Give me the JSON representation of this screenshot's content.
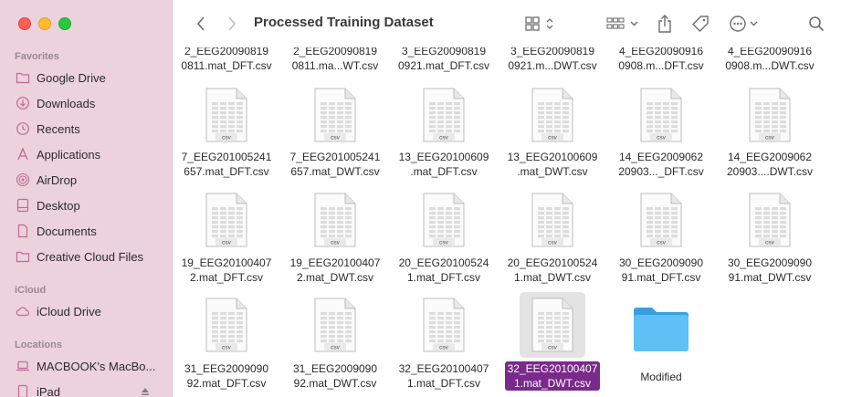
{
  "window": {
    "title": "Processed Training Dataset"
  },
  "sidebar": {
    "sections": [
      {
        "heading": "Favorites",
        "items": [
          {
            "label": "Google Drive",
            "icon": "folder-icon"
          },
          {
            "label": "Downloads",
            "icon": "download-icon"
          },
          {
            "label": "Recents",
            "icon": "clock-icon"
          },
          {
            "label": "Applications",
            "icon": "applications-icon"
          },
          {
            "label": "AirDrop",
            "icon": "airdrop-icon"
          },
          {
            "label": "Desktop",
            "icon": "desktop-icon"
          },
          {
            "label": "Documents",
            "icon": "document-icon"
          },
          {
            "label": "Creative Cloud Files",
            "icon": "folder-icon"
          }
        ]
      },
      {
        "heading": "iCloud",
        "items": [
          {
            "label": "iCloud Drive",
            "icon": "cloud-icon"
          }
        ]
      },
      {
        "heading": "Locations",
        "items": [
          {
            "label": "MACBOOK's MacBo...",
            "icon": "laptop-icon"
          },
          {
            "label": "iPad",
            "icon": "ipad-icon"
          }
        ]
      }
    ]
  },
  "files": {
    "top_row": [
      "2_EEG20090819\n0811.mat_DFT.csv",
      "2_EEG20090819\n0811.ma...WT.csv",
      "3_EEG20090819\n0921.mat_DFT.csv",
      "3_EEG20090819\n0921.m...DWT.csv",
      "4_EEG20090916\n0908.m...DFT.csv",
      "4_EEG20090916\n0908.m...DWT.csv"
    ],
    "rows": [
      [
        "7_EEG201005241\n657.mat_DFT.csv",
        "7_EEG201005241\n657.mat_DWT.csv",
        "13_EEG20100609\n.mat_DFT.csv",
        "13_EEG20100609\n.mat_DWT.csv",
        "14_EEG2009062\n20903..._DFT.csv",
        "14_EEG2009062\n20903....DWT.csv"
      ],
      [
        "19_EEG20100407\n2.mat_DFT.csv",
        "19_EEG20100407\n2.mat_DWT.csv",
        "20_EEG20100524\n1.mat_DFT.csv",
        "20_EEG20100524\n1.mat_DWT.csv",
        "30_EEG2009090\n91.mat_DFT.csv",
        "30_EEG2009090\n91.mat_DWT.csv"
      ],
      [
        "31_EEG2009090\n92.mat_DFT.csv",
        "31_EEG2009090\n92.mat_DWT.csv",
        "32_EEG20100407\n1.mat_DFT.csv",
        "32_EEG20100407\n1.mat_DWT.csv",
        "Modified"
      ]
    ],
    "csv_badge": "csv",
    "selected": "32_EEG20100407\n1.mat_DWT.csv"
  },
  "colors": {
    "selection": "#7a2a8a",
    "folder": "#5ab8f0",
    "sidebar_bg": "#ecd2dc"
  }
}
